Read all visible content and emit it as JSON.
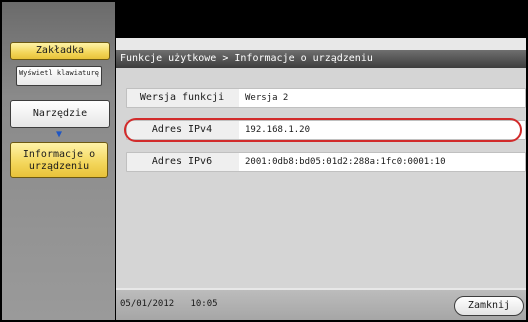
{
  "left_nav": {
    "tab_label": "Zakładka",
    "keyboard_label": "Wyświetl klawiaturę",
    "tools_label": "Narzędzie",
    "arrow_glyph": "▼",
    "info_label": "Informacje o urządzeniu"
  },
  "header": {
    "breadcrumb": "Funkcje użytkowe > Informacje o urządzeniu"
  },
  "info_rows": [
    {
      "label": "Wersja funkcji",
      "value": "Wersja 2"
    },
    {
      "label": "Adres IPv4",
      "value": "192.168.1.20"
    },
    {
      "label": "Adres IPv6",
      "value": "2001:0db8:bd05:01d2:288a:1fc0:0001:10"
    }
  ],
  "status": {
    "clock": "05/01/2012   10:05",
    "close_label": "Zamknij"
  },
  "colors": {
    "accent_yellow": "#f3d65a",
    "highlight_red": "#d22b2b",
    "title_bar": "#3d3d3d"
  }
}
